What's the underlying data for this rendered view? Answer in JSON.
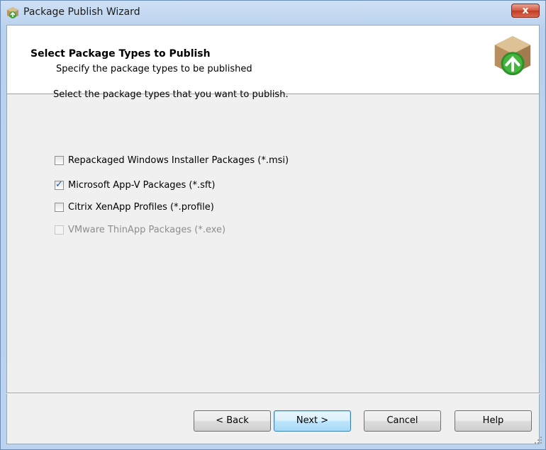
{
  "window": {
    "title": "Package Publish Wizard",
    "close_label": "x",
    "icon": "package-app-icon",
    "accent_color": "#c23a21"
  },
  "header": {
    "title": "Select Package Types to Publish",
    "subtitle": "Specify the package types to be published",
    "icon": "package-green-arrow-icon"
  },
  "body": {
    "prompt": "Select the package types that you want to publish.",
    "options": [
      {
        "label": "Repackaged Windows Installer Packages (*.msi)",
        "checked": false,
        "enabled": true
      },
      {
        "label": "Microsoft App-V Packages (*.sft)",
        "checked": true,
        "enabled": true
      },
      {
        "label": "Citrix XenApp Profiles (*.profile)",
        "checked": false,
        "enabled": true
      },
      {
        "label": "VMware ThinApp Packages (*.exe)",
        "checked": false,
        "enabled": false
      }
    ]
  },
  "footer": {
    "back_label": "< Back",
    "next_label": "Next >",
    "cancel_label": "Cancel",
    "help_label": "Help"
  }
}
